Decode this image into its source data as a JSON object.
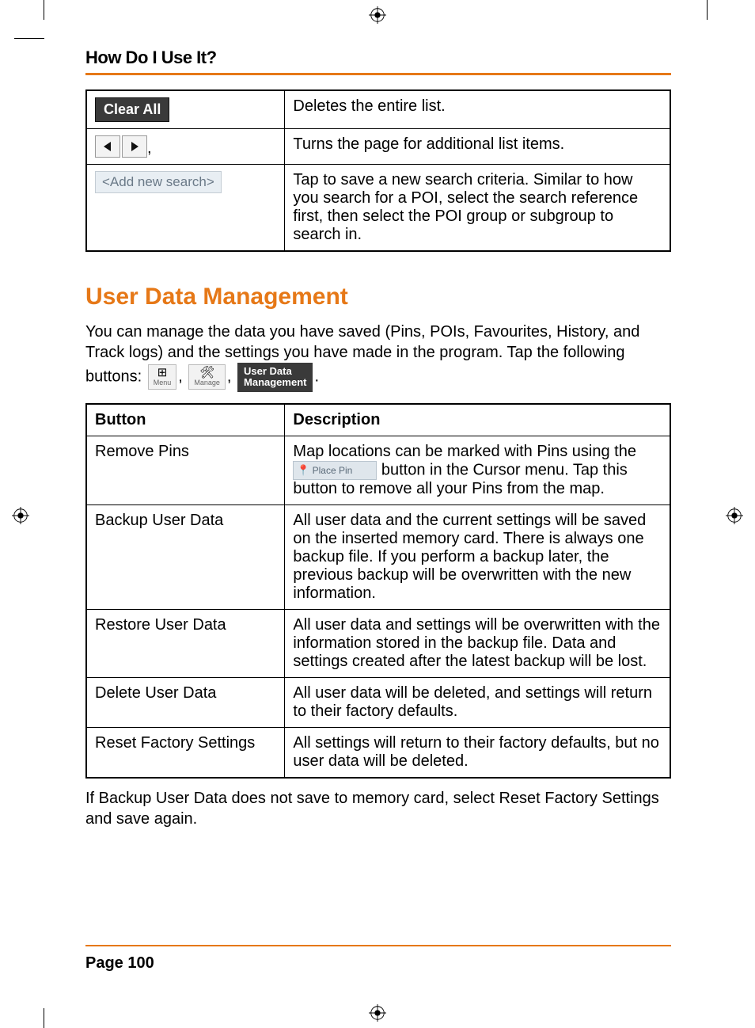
{
  "header": {
    "title": "How Do I Use It?"
  },
  "table1": {
    "rows": [
      {
        "button_label": "Clear All",
        "desc": "Deletes the entire list."
      },
      {
        "button_label": "nav-arrows",
        "desc": "Turns the page for additional list items."
      },
      {
        "button_label": "<Add new search>",
        "desc": "Tap to save a new search criteria. Similar to how you search for a POI, select the search reference first, then select the POI group or subgroup to search in."
      }
    ]
  },
  "section": {
    "title": "User Data Management",
    "intro_a": "You can manage the data you have saved (Pins, POIs, Favourites, History, and Track logs) and the settings you have made in the program. Tap the following buttons: ",
    "menu_label": "Menu",
    "manage_label": "Manage",
    "udm_label_line1": "User Data",
    "udm_label_line2": "Management",
    "period": "."
  },
  "table2": {
    "headers": {
      "col1": "Button",
      "col2": "Description"
    },
    "rows": [
      {
        "button": "Remove Pins",
        "desc_a": "Map locations can be marked with Pins using the ",
        "place_pin_label": "Place Pin",
        "desc_b": " button in the Cursor menu. Tap this button to remove all your Pins from the map."
      },
      {
        "button": "Backup User Data",
        "desc": "All user data and the current settings will be saved on the inserted memory card. There is always one backup file. If you perform a backup later, the previous backup will be overwritten with the new information."
      },
      {
        "button": "Restore User Data",
        "desc": "All user data and settings will be overwritten with the information stored in the backup file. Data and settings created after the latest backup will be lost."
      },
      {
        "button": "Delete User Data",
        "desc": "All user data will be deleted, and settings will return to their factory defaults."
      },
      {
        "button": "Reset Factory Settings",
        "desc": "All settings will return to their factory defaults, but no user data will be deleted."
      }
    ]
  },
  "note": "If Backup User Data does not save to memory card, select Reset Factory Settings and save again.",
  "footer": {
    "page": "Page 100"
  }
}
